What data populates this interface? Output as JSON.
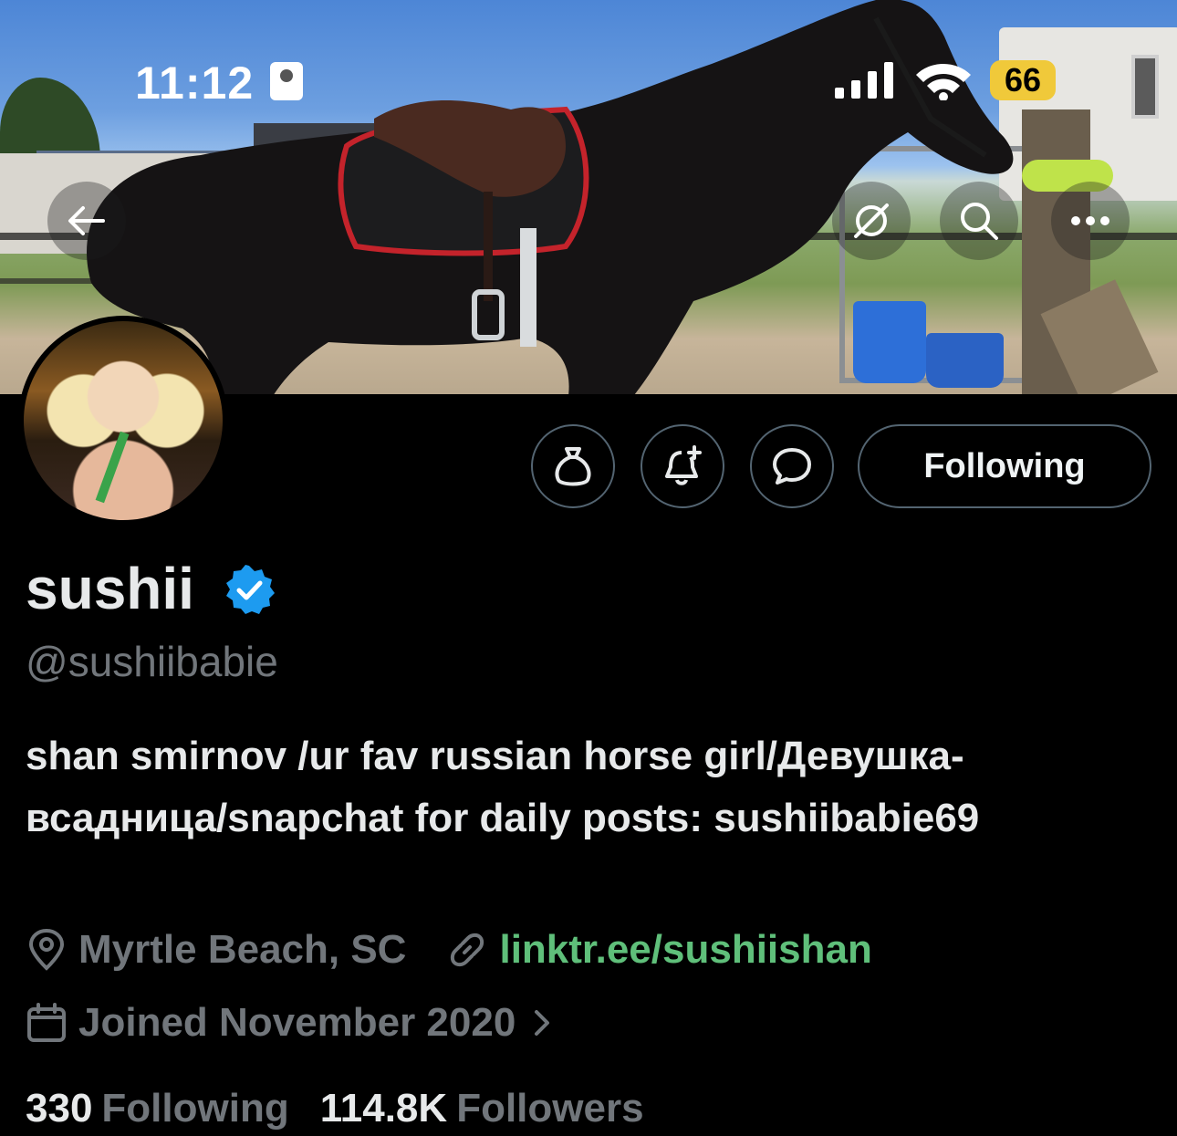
{
  "status_bar": {
    "time": "11:12",
    "battery": "66"
  },
  "colors": {
    "background": "#000000",
    "text_primary": "#e7e9ea",
    "text_secondary": "#71767b",
    "verified": "#1d9bf0",
    "link": "#5fbf7a",
    "button_border": "#536471",
    "battery": "#f0c93a"
  },
  "header": {
    "icons": [
      "back-arrow-icon",
      "grok-icon",
      "search-icon",
      "more-icon"
    ]
  },
  "profile": {
    "name": "sushii",
    "handle": "@sushiibabie",
    "bio": "shan smirnov /ur fav russian horse girl/Девушка-всадница/snapchat for daily posts: sushiibabie69",
    "location": "Myrtle Beach, SC",
    "link": "linktr.ee/sushiishan",
    "joined": "Joined November 2020",
    "following_count": "330",
    "following_label": "Following",
    "followers_count": "114.8K",
    "followers_label": "Followers"
  },
  "actions": {
    "follow_button_label": "Following",
    "icons": [
      "money-bag-icon",
      "bell-plus-icon",
      "message-icon"
    ]
  }
}
